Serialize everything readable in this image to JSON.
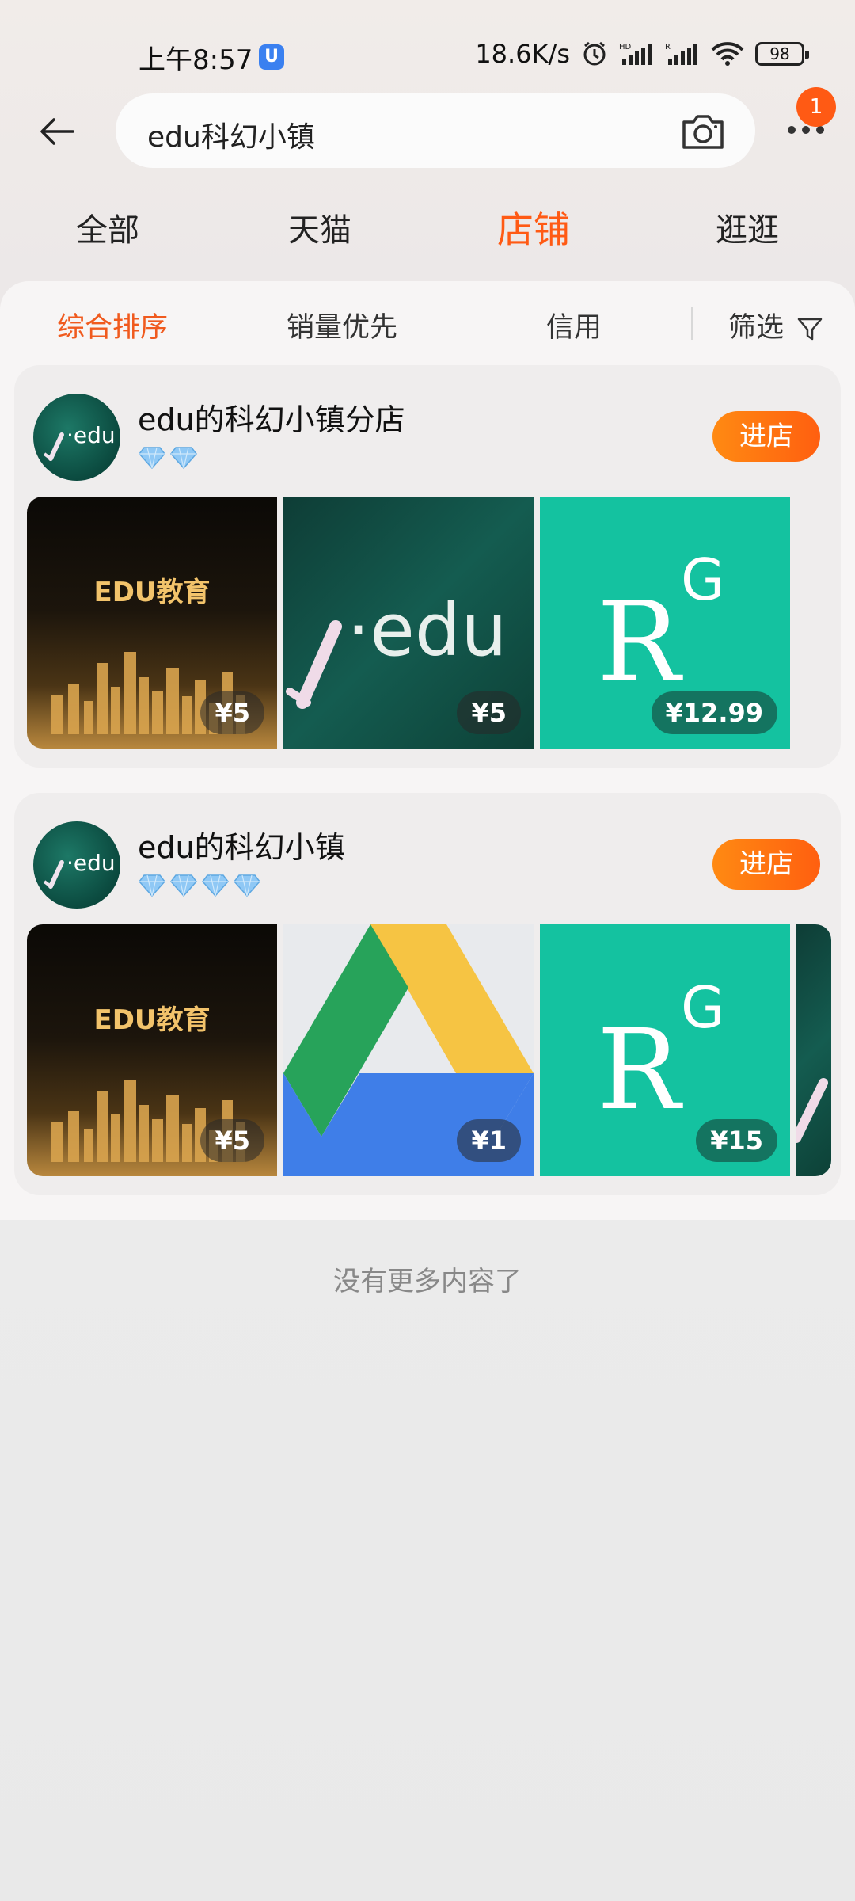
{
  "status_bar": {
    "time": "上午8:57",
    "net_speed": "18.6K/s",
    "battery": "98"
  },
  "header": {
    "search_query": "edu科幻小镇",
    "notification_count": "1"
  },
  "top_tabs": [
    {
      "label": "全部",
      "active": false
    },
    {
      "label": "天猫",
      "active": false
    },
    {
      "label": "店铺",
      "active": true
    },
    {
      "label": "逛逛",
      "active": false
    }
  ],
  "sort_bar": {
    "items": [
      {
        "label": "综合排序",
        "active": true
      },
      {
        "label": "销量优先",
        "active": false
      },
      {
        "label": "信用",
        "active": false
      }
    ],
    "filter_label": "筛选"
  },
  "shops": [
    {
      "name": "edu的科幻小镇分店",
      "diamonds": 2,
      "enter_label": "进店",
      "products": [
        {
          "image": "edu-gold-city",
          "overlay_text": "EDU教育",
          "price": "¥5"
        },
        {
          "image": "chalkboard-edu",
          "price": "¥5"
        },
        {
          "image": "researchgate-rg",
          "price": "¥12.99"
        }
      ]
    },
    {
      "name": "edu的科幻小镇",
      "diamonds": 4,
      "enter_label": "进店",
      "products": [
        {
          "image": "edu-gold-city",
          "overlay_text": "EDU教育",
          "price": "¥5"
        },
        {
          "image": "google-drive-logo",
          "price": "¥1"
        },
        {
          "image": "researchgate-rg",
          "price": "¥15"
        },
        {
          "image": "chalkboard-edu-partial",
          "price": ""
        }
      ]
    }
  ],
  "footer": {
    "no_more_text": "没有更多内容了"
  },
  "colors": {
    "accent": "#ff5a14",
    "enter_button_start": "#ff8a12",
    "enter_button_end": "#ff5f10",
    "diamond": "#8fc8f5"
  }
}
